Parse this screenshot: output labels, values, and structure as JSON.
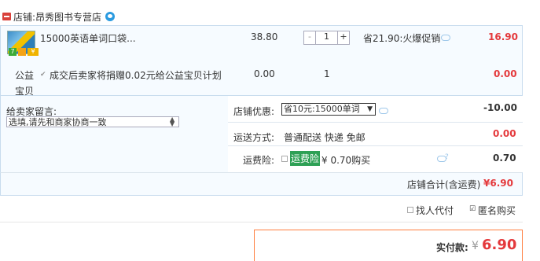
{
  "shop": {
    "label": "店铺:",
    "name": "昂秀图书专营店"
  },
  "item": {
    "title": "15000英语单词口袋...",
    "price": "38.80",
    "qty_minus": "-",
    "qty": "1",
    "qty_plus": "+",
    "promo": "省21.90:火爆促销",
    "subtotal": "16.90",
    "tag_7": "7",
    "tag_2": "¥"
  },
  "charity": {
    "label": "公益",
    "text_line1": "成交后卖家将捐赠0.02元给公益宝贝计划",
    "text_line2": "宝贝",
    "price": "0.00",
    "qty": "1",
    "subtotal": "0.00"
  },
  "note": {
    "label": "给卖家留言:",
    "placeholder": "选填,请先和商家协商一致"
  },
  "discount": {
    "label": "店铺优惠:",
    "selected": "省10元:15000单词",
    "value": "-10.00"
  },
  "shipping": {
    "label": "运送方式:",
    "value": "普通配送 快递 免邮",
    "fee": "0.00"
  },
  "insurance": {
    "label": "运费险:",
    "name": "运费险",
    "desc": "¥ 0.70购买",
    "fee": "0.70"
  },
  "shop_total": {
    "label": "店铺合计(含运费)",
    "value": "¥6.90"
  },
  "options": {
    "proxy": "找人代付",
    "anonymous": "匿名购买"
  },
  "pay": {
    "label": "实付款:",
    "currency": "¥",
    "amount": "6.90"
  }
}
